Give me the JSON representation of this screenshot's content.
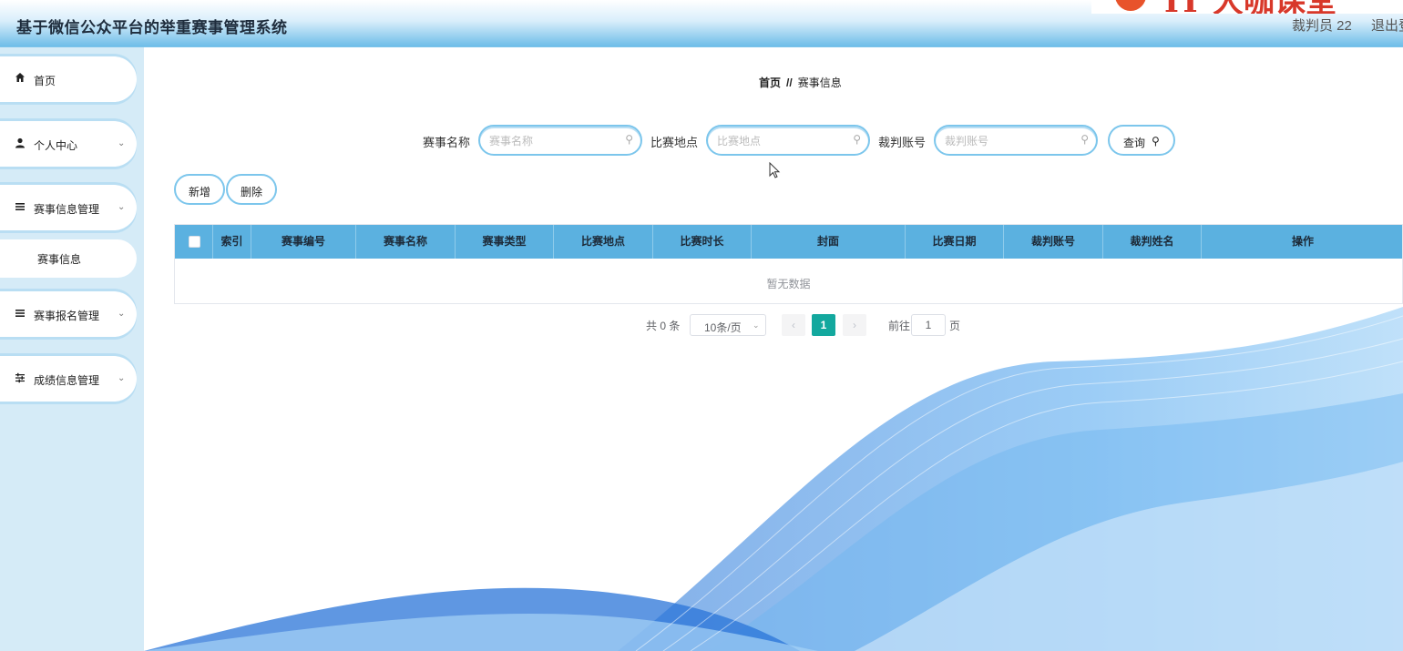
{
  "app": {
    "title": "基于微信公众平台的举重赛事管理系统",
    "user": "裁判员 22",
    "logout": "退出登录",
    "watermark": "IT 大咖课堂"
  },
  "sidebar": {
    "items": [
      {
        "icon": "home-icon",
        "label": "首页",
        "has_arrow": false
      },
      {
        "icon": "person-icon",
        "label": "个人中心",
        "has_arrow": true
      },
      {
        "icon": "list-icon",
        "label": "赛事信息管理",
        "has_arrow": true,
        "expanded": true
      },
      {
        "icon": "list-icon",
        "label": "赛事报名管理",
        "has_arrow": true
      },
      {
        "icon": "sliders-icon",
        "label": "成绩信息管理",
        "has_arrow": true
      }
    ],
    "subitems": [
      {
        "label": "赛事信息",
        "parent": "赛事信息管理"
      }
    ]
  },
  "breadcrumb": {
    "home": "首页",
    "separator": "//",
    "current": "赛事信息"
  },
  "search": {
    "fields": [
      {
        "label": "赛事名称",
        "placeholder": "赛事名称",
        "value": ""
      },
      {
        "label": "比赛地点",
        "placeholder": "比赛地点",
        "value": ""
      },
      {
        "label": "裁判账号",
        "placeholder": "裁判账号",
        "value": ""
      }
    ],
    "query_label": "查询"
  },
  "actions": {
    "add_label": "新增",
    "delete_label": "删除"
  },
  "table": {
    "columns": [
      "索引",
      "赛事编号",
      "赛事名称",
      "赛事类型",
      "比赛地点",
      "比赛时长",
      "封面",
      "比赛日期",
      "裁判账号",
      "裁判姓名",
      "操作"
    ],
    "rows": [],
    "empty_text": "暂无数据"
  },
  "pagination": {
    "total": "共 0 条",
    "page_size": "10条/页",
    "current_page": "1",
    "goto_label": "前往",
    "goto_value": "1",
    "page_suffix": "页"
  },
  "colors": {
    "accent": "#5bb1e0",
    "sidebar_bg": "#d5ebf7",
    "pagination_active": "#13a89e"
  }
}
